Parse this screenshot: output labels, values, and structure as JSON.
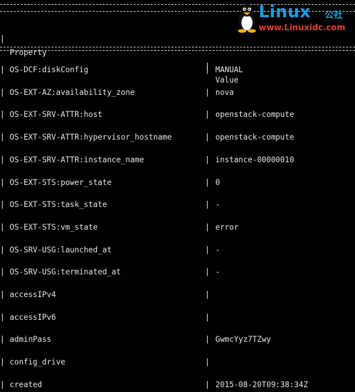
{
  "header": {
    "property": "Property",
    "value": "Value"
  },
  "watermark": {
    "brand": "Linux",
    "cn": "公社",
    "url": "www.Linuxidc.com"
  },
  "rows": [
    {
      "property": "OS-DCF:diskConfig",
      "value": "MANUAL"
    },
    {
      "property": "OS-EXT-AZ:availability_zone",
      "value": "nova"
    },
    {
      "property": "OS-EXT-SRV-ATTR:host",
      "value": "openstack-compute"
    },
    {
      "property": "OS-EXT-SRV-ATTR:hypervisor_hostname",
      "value": "openstack-compute"
    },
    {
      "property": "OS-EXT-SRV-ATTR:instance_name",
      "value": "instance-00000010"
    },
    {
      "property": "OS-EXT-STS:power_state",
      "value": "0"
    },
    {
      "property": "OS-EXT-STS:task_state",
      "value": "-"
    },
    {
      "property": "OS-EXT-STS:vm_state",
      "value": "error"
    },
    {
      "property": "OS-SRV-USG:launched_at",
      "value": "-"
    },
    {
      "property": "OS-SRV-USG:terminated_at",
      "value": "-"
    },
    {
      "property": "accessIPv4",
      "value": ""
    },
    {
      "property": "accessIPv6",
      "value": ""
    },
    {
      "property": "adminPass",
      "value": "GwmcYyz7TZwy"
    },
    {
      "property": "config_drive",
      "value": ""
    },
    {
      "property": "created",
      "value": "2015-08-20T09:38:34Z"
    }
  ]
}
